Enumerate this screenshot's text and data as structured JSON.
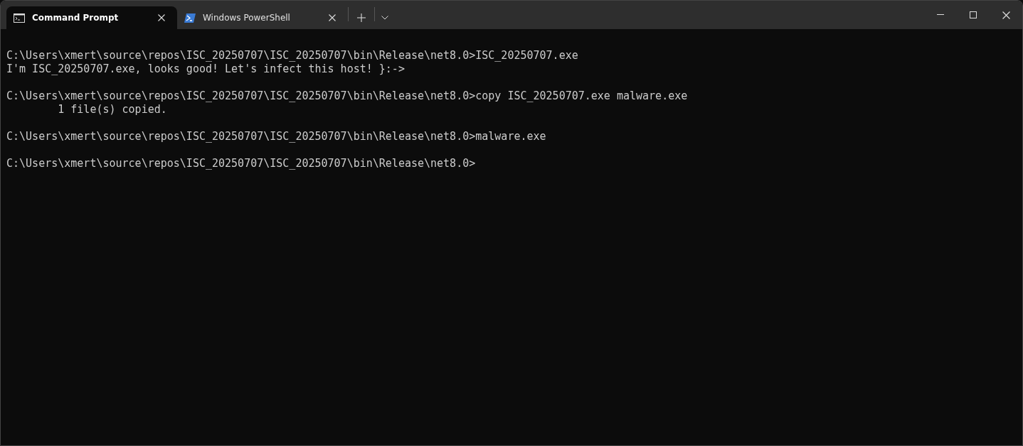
{
  "tabs": [
    {
      "title": "Command Prompt",
      "kind": "cmd",
      "selected": true
    },
    {
      "title": "Windows PowerShell",
      "kind": "powershell",
      "selected": false
    }
  ],
  "terminal": {
    "blocks": [
      [
        "C:\\Users\\xmert\\source\\repos\\ISC_20250707\\ISC_20250707\\bin\\Release\\net8.0>ISC_20250707.exe",
        "I'm ISC_20250707.exe, looks good! Let's infect this host! }:->"
      ],
      [
        "C:\\Users\\xmert\\source\\repos\\ISC_20250707\\ISC_20250707\\bin\\Release\\net8.0>copy ISC_20250707.exe malware.exe",
        "        1 file(s) copied."
      ],
      [
        "C:\\Users\\xmert\\source\\repos\\ISC_20250707\\ISC_20250707\\bin\\Release\\net8.0>malware.exe"
      ],
      [
        "C:\\Users\\xmert\\source\\repos\\ISC_20250707\\ISC_20250707\\bin\\Release\\net8.0>"
      ]
    ]
  }
}
